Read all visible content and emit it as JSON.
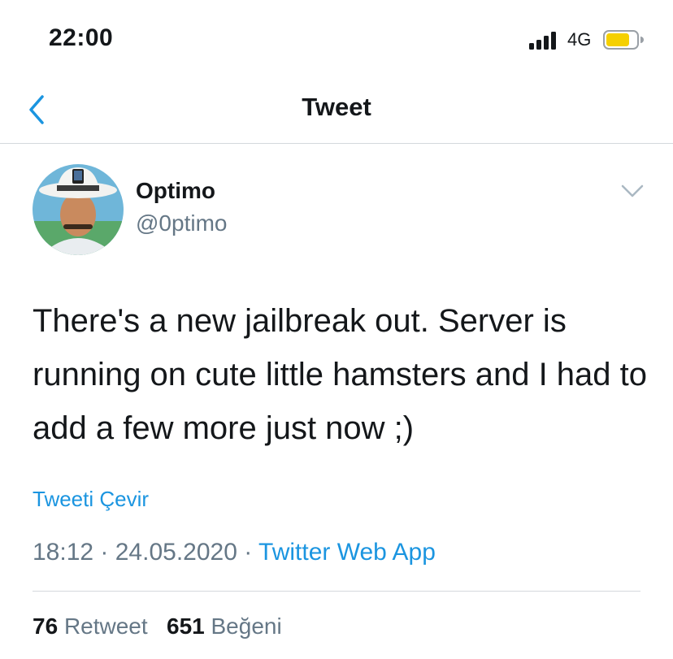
{
  "status_bar": {
    "time": "22:00",
    "network": "4G",
    "battery_color": "#f5d000"
  },
  "nav": {
    "title": "Tweet",
    "back_icon": "chevron-left-icon"
  },
  "author": {
    "name": "Optimo",
    "handle": "@0ptimo"
  },
  "tweet": {
    "text": "There's a new jailbreak out. Server is running on cute little hamsters and I had to add a few more just now ;)",
    "translate_label": "Tweeti Çevir",
    "time": "18:12",
    "separator": " · ",
    "date": "24.05.2020",
    "source": "Twitter Web App"
  },
  "stats": {
    "retweets_count": "76",
    "retweets_label": "Retweet",
    "likes_count": "651",
    "likes_label": "Beğeni"
  },
  "colors": {
    "link": "#1b95e0",
    "secondary_text": "#657786",
    "divider": "#d4d8dc"
  }
}
